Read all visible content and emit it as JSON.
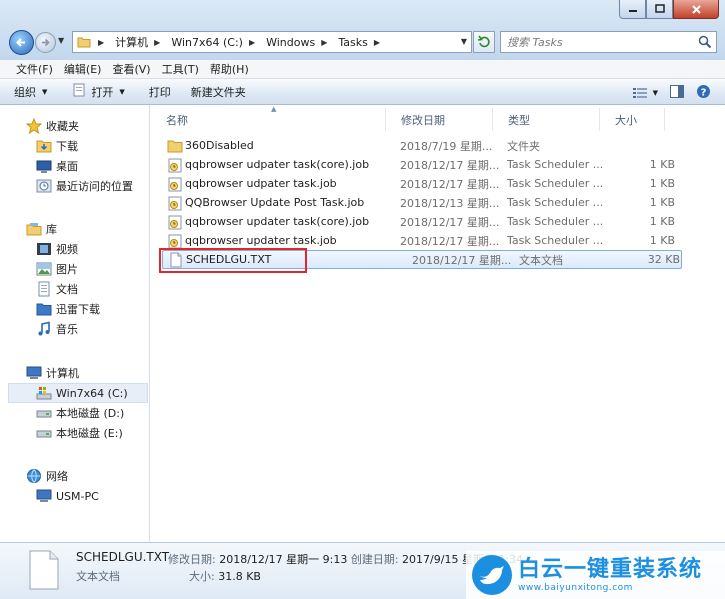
{
  "address": {
    "crumbs": [
      "计算机",
      "Win7x64 (C:)",
      "Windows",
      "Tasks"
    ]
  },
  "search": {
    "placeholder": "搜索 Tasks"
  },
  "menu": [
    "文件(F)",
    "编辑(E)",
    "查看(V)",
    "工具(T)",
    "帮助(H)"
  ],
  "commands": {
    "organize": "组织",
    "open": "打开",
    "print": "打印",
    "new_folder": "新建文件夹"
  },
  "nav": {
    "favorites": {
      "label": "收藏夹",
      "items": [
        "下载",
        "桌面",
        "最近访问的位置"
      ]
    },
    "libraries": {
      "label": "库",
      "items": [
        "视频",
        "图片",
        "文档",
        "迅雷下载",
        "音乐"
      ]
    },
    "computer": {
      "label": "计算机",
      "items": [
        "Win7x64 (C:)",
        "本地磁盘 (D:)",
        "本地磁盘 (E:)"
      ]
    },
    "network": {
      "label": "网络",
      "items": [
        "USM-PC"
      ]
    }
  },
  "columns": {
    "name": "名称",
    "date": "修改日期",
    "type": "类型",
    "size": "大小"
  },
  "files": [
    {
      "name": "360Disabled",
      "date": "2018/7/19 星期...",
      "type": "文件夹",
      "size": "",
      "icon": "folder-icon"
    },
    {
      "name": "qqbrowser udpater task(core).job",
      "date": "2018/12/17 星期...",
      "type": "Task Scheduler ...",
      "size": "1 KB",
      "icon": "task-job-icon"
    },
    {
      "name": "qqbrowser udpater task.job",
      "date": "2018/12/17 星期...",
      "type": "Task Scheduler ...",
      "size": "1 KB",
      "icon": "task-job-icon"
    },
    {
      "name": "QQBrowser Update Post Task.job",
      "date": "2018/12/13 星期...",
      "type": "Task Scheduler ...",
      "size": "1 KB",
      "icon": "task-job-icon"
    },
    {
      "name": "qqbrowser updater task(core).job",
      "date": "2018/12/17 星期...",
      "type": "Task Scheduler ...",
      "size": "1 KB",
      "icon": "task-job-icon"
    },
    {
      "name": "qqbrowser updater task.job",
      "date": "2018/12/17 星期...",
      "type": "Task Scheduler ...",
      "size": "1 KB",
      "icon": "task-job-icon"
    },
    {
      "name": "SCHEDLGU.TXT",
      "date": "2018/12/17 星期...",
      "type": "文本文档",
      "size": "32 KB",
      "icon": "text-file-icon",
      "selected": true
    }
  ],
  "details": {
    "name": "SCHEDLGU.TXT",
    "type": "文本文档",
    "modified_label": "修改日期:",
    "modified": "2018/12/17 星期一 9:13",
    "created_label": "创建日期:",
    "created": "2017/9/15 星期五 1:34",
    "size_label": "大小:",
    "size": "31.8 KB"
  },
  "watermark": {
    "title": "白云一键重装系统",
    "url": "www.baiyunxitong.com"
  },
  "colors": {
    "selection": "#dbeafc",
    "highlight": "#e2262b",
    "brand": "#1d8fe1"
  }
}
